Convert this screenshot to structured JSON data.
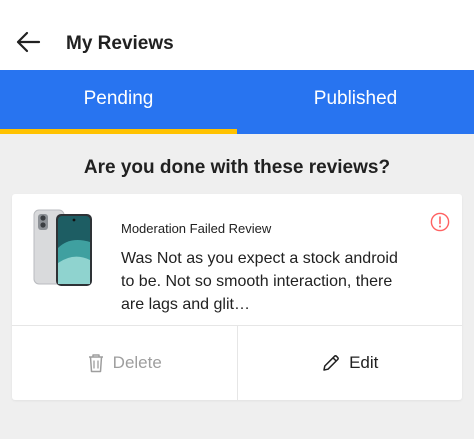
{
  "header": {
    "title": "My Reviews",
    "back_icon": "arrow-left-icon"
  },
  "tabs": [
    {
      "label": "Pending",
      "active": true
    },
    {
      "label": "Published",
      "active": false
    }
  ],
  "colors": {
    "brand_blue": "#2874f0",
    "tab_indicator": "#ffc200",
    "alert_red": "#ff6161"
  },
  "prompt": "Are you done with these reviews?",
  "review_card": {
    "status": "Moderation Failed Review",
    "review_text": "Was Not as you expect a stock android to be. Not so smooth interaction, there are lags and glit…",
    "status_icon": "alert-circle-icon",
    "delete_label": "Delete",
    "edit_label": "Edit"
  }
}
